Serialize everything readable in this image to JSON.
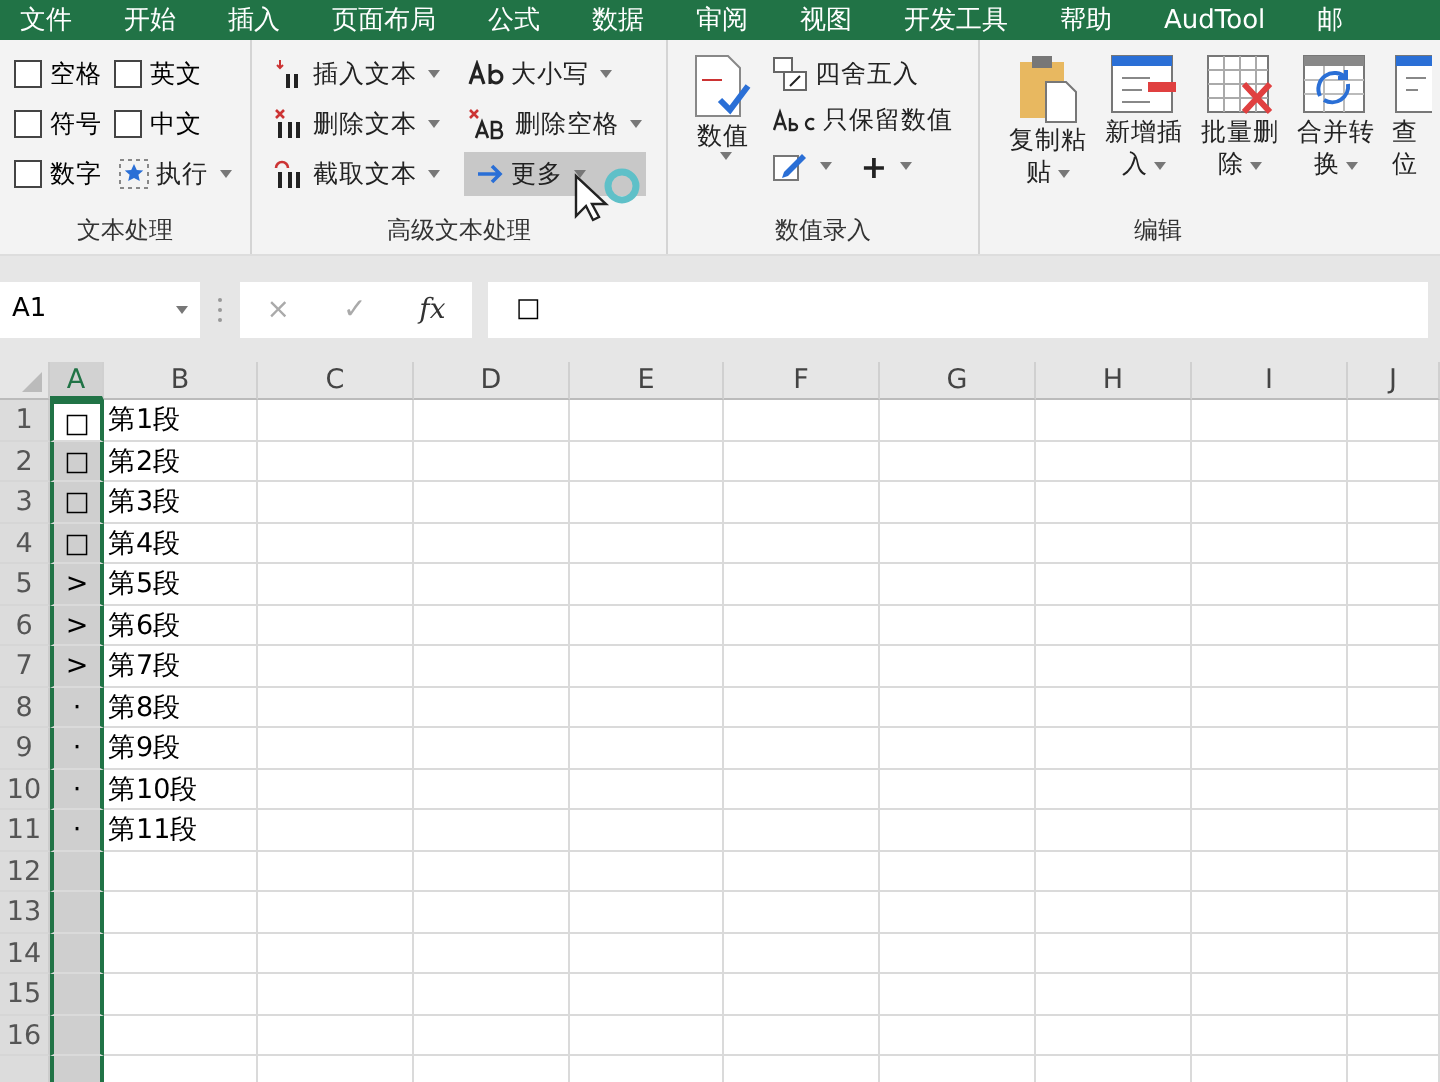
{
  "tabs": [
    "文件",
    "开始",
    "插入",
    "页面布局",
    "公式",
    "数据",
    "审阅",
    "视图",
    "开发工具",
    "帮助",
    "AudTool",
    "邮"
  ],
  "ribbon": {
    "groups": [
      {
        "label": "文本处理",
        "checkboxes": [
          {
            "label": "空格",
            "checked": false
          },
          {
            "label": "英文",
            "checked": false
          },
          {
            "label": "符号",
            "checked": false
          },
          {
            "label": "中文",
            "checked": false
          },
          {
            "label": "数字",
            "checked": false
          }
        ],
        "button": {
          "label": "执行",
          "dropdown": true
        }
      },
      {
        "label": "高级文本处理",
        "buttons": [
          {
            "label": "插入文本",
            "dropdown": true,
            "hovered": false
          },
          {
            "label": "删除文本",
            "dropdown": true,
            "hovered": false
          },
          {
            "label": "截取文本",
            "dropdown": true,
            "hovered": false
          },
          {
            "label": "大小写",
            "dropdown": true,
            "hovered": false
          },
          {
            "label": "删除空格",
            "dropdown": true,
            "hovered": false
          },
          {
            "label": "更多",
            "dropdown": true,
            "hovered": true
          }
        ]
      },
      {
        "label": "数值录入",
        "large": {
          "lines": [
            "数值"
          ],
          "dropdown": true
        },
        "buttons": [
          {
            "label": "四舍五入",
            "dropdown": false
          },
          {
            "label": "只保留数值",
            "dropdown": false
          }
        ],
        "extra": [
          {
            "dropdown": true
          },
          {
            "label": "+",
            "dropdown": true
          }
        ]
      },
      {
        "label": "编辑",
        "large_buttons": [
          {
            "lines": [
              "复制粘",
              "贴"
            ],
            "dropdown": true
          },
          {
            "lines": [
              "新增插",
              "入"
            ],
            "dropdown": true
          },
          {
            "lines": [
              "批量删",
              "除"
            ],
            "dropdown": true
          },
          {
            "lines": [
              "合并转",
              "换"
            ],
            "dropdown": true
          },
          {
            "lines": [
              "查",
              "位"
            ],
            "dropdown": false
          }
        ]
      }
    ]
  },
  "formula_bar": {
    "name_box": "A1",
    "cancel": "×",
    "enter": "✓",
    "function": "fx",
    "content": "□"
  },
  "sheet": {
    "columns": [
      {
        "label": "A",
        "selected": true
      },
      {
        "label": "B",
        "selected": false
      },
      {
        "label": "C",
        "selected": false
      },
      {
        "label": "D",
        "selected": false
      },
      {
        "label": "E",
        "selected": false
      },
      {
        "label": "F",
        "selected": false
      },
      {
        "label": "G",
        "selected": false
      },
      {
        "label": "H",
        "selected": false
      },
      {
        "label": "I",
        "selected": false
      },
      {
        "label": "J",
        "selected": false
      }
    ],
    "rows": [
      {
        "number": "1",
        "active": true,
        "cells": [
          "□",
          "第1段"
        ]
      },
      {
        "number": "2",
        "active": false,
        "cells": [
          "□",
          "第2段"
        ]
      },
      {
        "number": "3",
        "active": false,
        "cells": [
          "□",
          "第3段"
        ]
      },
      {
        "number": "4",
        "active": false,
        "cells": [
          "□",
          "第4段"
        ]
      },
      {
        "number": "5",
        "active": false,
        "cells": [
          ">",
          "第5段"
        ]
      },
      {
        "number": "6",
        "active": false,
        "cells": [
          ">",
          "第6段"
        ]
      },
      {
        "number": "7",
        "active": false,
        "cells": [
          ">",
          "第7段"
        ]
      },
      {
        "number": "8",
        "active": false,
        "cells": [
          "·",
          "第8段"
        ]
      },
      {
        "number": "9",
        "active": false,
        "cells": [
          "·",
          "第9段"
        ]
      },
      {
        "number": "10",
        "active": false,
        "cells": [
          "·",
          "第10段"
        ]
      },
      {
        "number": "11",
        "active": false,
        "cells": [
          "·",
          "第11段"
        ]
      },
      {
        "number": "12",
        "active": false,
        "cells": []
      },
      {
        "number": "13",
        "active": false,
        "cells": []
      },
      {
        "number": "14",
        "active": false,
        "cells": []
      },
      {
        "number": "15",
        "active": false,
        "cells": []
      },
      {
        "number": "16",
        "active": false,
        "cells": []
      },
      {
        "active": false,
        "cells": []
      }
    ]
  }
}
